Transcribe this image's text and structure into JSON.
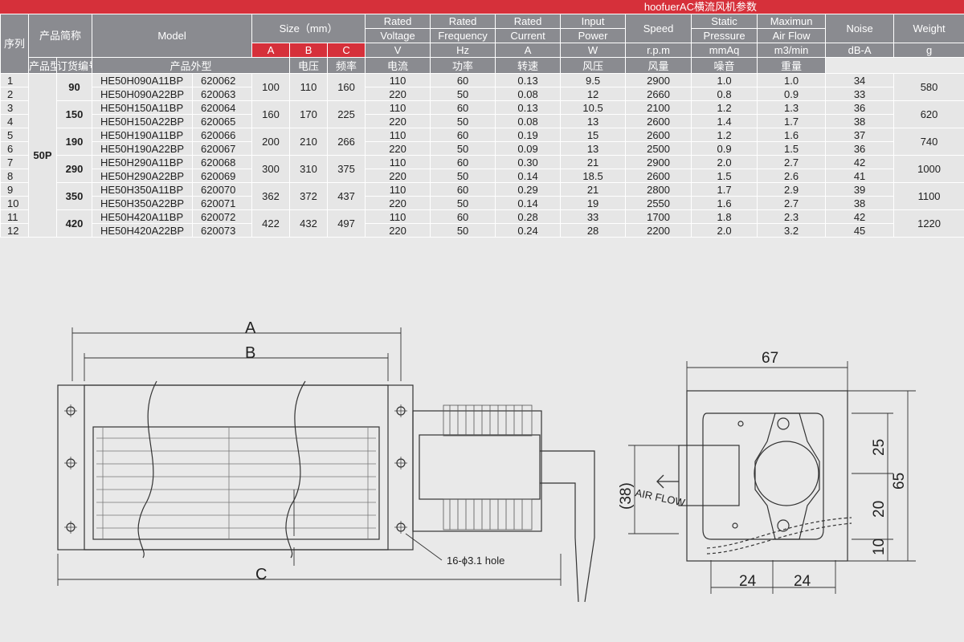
{
  "banner": "hoofuerAC横流风机参数",
  "headers": {
    "seq": "序列",
    "short_name": "产品简称",
    "model": "Model",
    "size": "Size（mm）",
    "size_a": "A",
    "size_b": "B",
    "size_c": "C",
    "voltage_1": "Rated",
    "voltage_2": "Voltage",
    "voltage_unit": "V",
    "freq_1": "Rated",
    "freq_2": "Frequency",
    "freq_unit": "Hz",
    "current_1": "Rated",
    "current_2": "Current",
    "current_unit": "A",
    "power_1": "Input",
    "power_2": "Power",
    "power_unit": "W",
    "speed": "Speed",
    "speed_unit": "r.p.m",
    "pressure_1": "Static",
    "pressure_2": "Pressure",
    "pressure_unit": "mmAq",
    "flow_1": "Maximun",
    "flow_2": "Air Flow",
    "flow_unit": "m3/min",
    "noise": "Noise",
    "noise_unit": "dB-A",
    "weight": "Weight",
    "weight_unit": "g",
    "cn_model": "产品型号",
    "cn_order": "订货编号",
    "cn_size": "产品外型",
    "cn_voltage": "电压",
    "cn_freq": "频率",
    "cn_current": "电流",
    "cn_power": "功率",
    "cn_speed": "转速",
    "cn_pressure": "风压",
    "cn_flow": "风量",
    "cn_noise": "噪音",
    "cn_weight": "重量"
  },
  "series_label": "50P",
  "groups": [
    {
      "short": "90",
      "a": "100",
      "b": "110",
      "c": "160",
      "weight": "580",
      "rows": [
        {
          "seq": "1",
          "model": "HE50H090A11BP",
          "order": "620062",
          "v": "110",
          "hz": "60",
          "a": "0.13",
          "w": "9.5",
          "rpm": "2900",
          "p": "1.0",
          "f": "1.0",
          "n": "34"
        },
        {
          "seq": "2",
          "model": "HE50H090A22BP",
          "order": "620063",
          "v": "220",
          "hz": "50",
          "a": "0.08",
          "w": "12",
          "rpm": "2660",
          "p": "0.8",
          "f": "0.9",
          "n": "33"
        }
      ]
    },
    {
      "short": "150",
      "a": "160",
      "b": "170",
      "c": "225",
      "weight": "620",
      "rows": [
        {
          "seq": "3",
          "model": "HE50H150A11BP",
          "order": "620064",
          "v": "110",
          "hz": "60",
          "a": "0.13",
          "w": "10.5",
          "rpm": "2100",
          "p": "1.2",
          "f": "1.3",
          "n": "36"
        },
        {
          "seq": "4",
          "model": "HE50H150A22BP",
          "order": "620065",
          "v": "220",
          "hz": "50",
          "a": "0.08",
          "w": "13",
          "rpm": "2600",
          "p": "1.4",
          "f": "1.7",
          "n": "38"
        }
      ]
    },
    {
      "short": "190",
      "a": "200",
      "b": "210",
      "c": "266",
      "weight": "740",
      "rows": [
        {
          "seq": "5",
          "model": "HE50H190A11BP",
          "order": "620066",
          "v": "110",
          "hz": "60",
          "a": "0.19",
          "w": "15",
          "rpm": "2600",
          "p": "1.2",
          "f": "1.6",
          "n": "37"
        },
        {
          "seq": "6",
          "model": "HE50H190A22BP",
          "order": "620067",
          "v": "220",
          "hz": "50",
          "a": "0.09",
          "w": "13",
          "rpm": "2500",
          "p": "0.9",
          "f": "1.5",
          "n": "36"
        }
      ]
    },
    {
      "short": "290",
      "a": "300",
      "b": "310",
      "c": "375",
      "weight": "1000",
      "rows": [
        {
          "seq": "7",
          "model": "HE50H290A11BP",
          "order": "620068",
          "v": "110",
          "hz": "60",
          "a": "0.30",
          "w": "21",
          "rpm": "2900",
          "p": "2.0",
          "f": "2.7",
          "n": "42"
        },
        {
          "seq": "8",
          "model": "HE50H290A22BP",
          "order": "620069",
          "v": "220",
          "hz": "50",
          "a": "0.14",
          "w": "18.5",
          "rpm": "2600",
          "p": "1.5",
          "f": "2.6",
          "n": "41"
        }
      ]
    },
    {
      "short": "350",
      "a": "362",
      "b": "372",
      "c": "437",
      "weight": "1100",
      "rows": [
        {
          "seq": "9",
          "model": "HE50H350A11BP",
          "order": "620070",
          "v": "110",
          "hz": "60",
          "a": "0.29",
          "w": "21",
          "rpm": "2800",
          "p": "1.7",
          "f": "2.9",
          "n": "39"
        },
        {
          "seq": "10",
          "model": "HE50H350A22BP",
          "order": "620071",
          "v": "220",
          "hz": "50",
          "a": "0.14",
          "w": "19",
          "rpm": "2550",
          "p": "1.6",
          "f": "2.7",
          "n": "38"
        }
      ]
    },
    {
      "short": "420",
      "a": "422",
      "b": "432",
      "c": "497",
      "weight": "1220",
      "rows": [
        {
          "seq": "11",
          "model": "HE50H420A11BP",
          "order": "620072",
          "v": "110",
          "hz": "60",
          "a": "0.28",
          "w": "33",
          "rpm": "1700",
          "p": "1.8",
          "f": "2.3",
          "n": "42"
        },
        {
          "seq": "12",
          "model": "HE50H420A22BP",
          "order": "620073",
          "v": "220",
          "hz": "50",
          "a": "0.24",
          "w": "28",
          "rpm": "2200",
          "p": "2.0",
          "f": "3.2",
          "n": "45"
        }
      ]
    }
  ],
  "drawing": {
    "dim_a": "A",
    "dim_b": "B",
    "dim_c": "C",
    "hole_note": "16-ϕ3.1 hole",
    "dim_67": "67",
    "dim_65": "65",
    "dim_25": "25",
    "dim_20": "20",
    "dim_10": "10",
    "dim_24a": "24",
    "dim_24b": "24",
    "dim_38": "(38)",
    "airflow": "AIR FLOW"
  }
}
